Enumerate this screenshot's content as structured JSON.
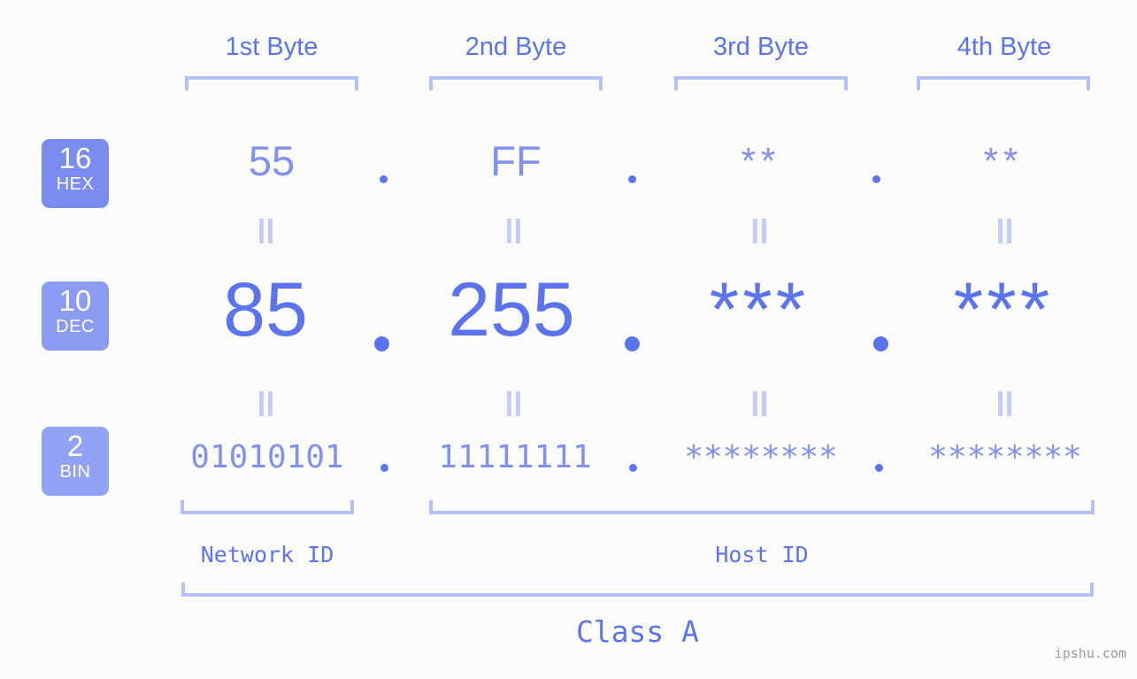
{
  "background_color": "#fcfdfa",
  "accent_color": "#5b74ee",
  "accent_light_color": "#8091f1",
  "bracket_color": "#b4c0fb",
  "header": {
    "bytes": [
      {
        "label": "1st Byte"
      },
      {
        "label": "2nd Byte"
      },
      {
        "label": "3rd Byte"
      },
      {
        "label": "4th Byte"
      }
    ]
  },
  "bases": [
    {
      "number": "16",
      "name": "HEX",
      "color": "#7b8cf0"
    },
    {
      "number": "10",
      "name": "DEC",
      "color": "#8c9bf2"
    },
    {
      "number": "2",
      "name": "BIN",
      "color": "#92a3f5"
    }
  ],
  "rows": {
    "hex": {
      "base_number": "16",
      "base_name": "HEX",
      "values": [
        "55",
        "FF",
        "**",
        "**"
      ],
      "separator": "."
    },
    "dec": {
      "base_number": "10",
      "base_name": "DEC",
      "values": [
        "85",
        "255",
        "***",
        "***"
      ],
      "separator": "."
    },
    "bin": {
      "base_number": "2",
      "base_name": "BIN",
      "values": [
        "01010101",
        "11111111",
        "********",
        "********"
      ],
      "separator": "."
    }
  },
  "equality_symbol": "=",
  "sections": {
    "network_id": "Network ID",
    "host_id": "Host ID",
    "class": "Class A"
  },
  "watermark": "ipshu.com"
}
